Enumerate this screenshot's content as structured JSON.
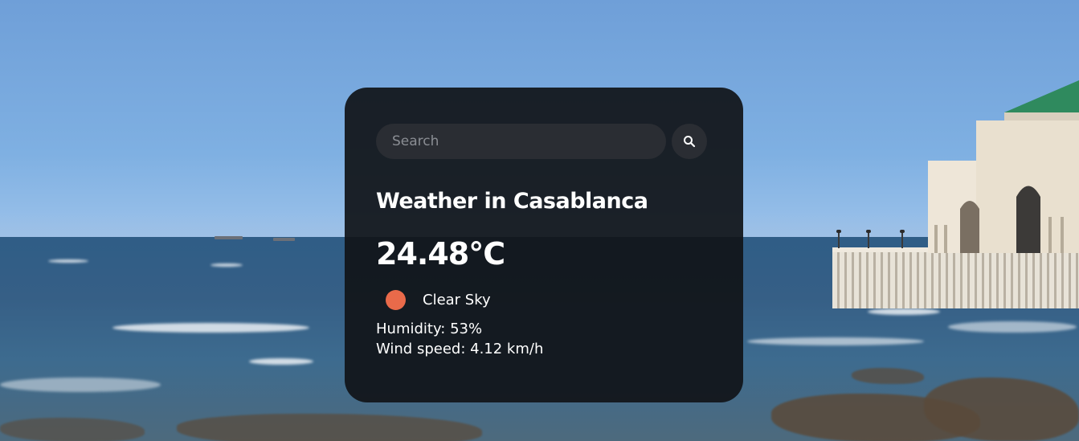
{
  "search": {
    "placeholder": "Search",
    "value": "",
    "button_icon": "search-icon"
  },
  "weather": {
    "title": "Weather in Casablanca",
    "temperature": "24.48°C",
    "icon": "sun-icon",
    "icon_color": "#e96a4a",
    "description": "Clear Sky",
    "humidity": "Humidity: 53%",
    "wind_speed": "Wind speed: 4.12 km/h"
  },
  "colors": {
    "card_background": "#111419",
    "input_background": "#2a2d33",
    "text": "#ffffff"
  }
}
